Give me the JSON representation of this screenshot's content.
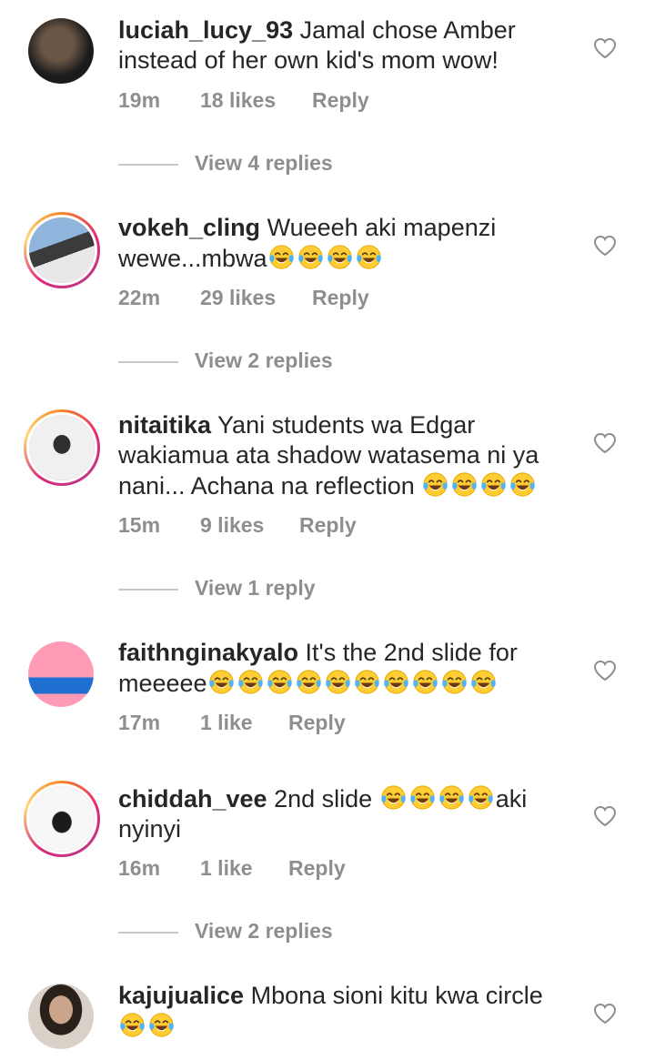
{
  "comments": [
    {
      "user": "luciah_lucy_93",
      "text": "Jamal chose Amber instead of her own kid's mom wow!",
      "emojis": 0,
      "time": "19m",
      "likes": "18 likes",
      "reply": "Reply",
      "view_replies": "View 4 replies",
      "avatar_colors": [
        "#1b1b1b",
        "#5a4636"
      ]
    },
    {
      "user": "vokeh_cling",
      "text": "Wueeeh aki mapenzi wewe...mbwa",
      "emojis": 4,
      "time": "22m",
      "likes": "29 likes",
      "reply": "Reply",
      "view_replies": "View 2 replies",
      "avatar_colors": [
        "#7a9ec9",
        "#d7dbe0"
      ]
    },
    {
      "user": "nitaitika",
      "text": "Yani students wa Edgar wakiamua ata shadow watasema ni ya nani... Achana na reflection ",
      "emojis": 4,
      "time": "15m",
      "likes": "9 likes",
      "reply": "Reply",
      "view_replies": "View 1 reply",
      "avatar_colors": [
        "#e9e9e9",
        "#3a3a3a"
      ]
    },
    {
      "user": "faithnginakyalo",
      "text": "It's the 2nd slide for meeeee",
      "emojis": 10,
      "time": "17m",
      "likes": "1 like",
      "reply": "Reply",
      "view_replies": "",
      "avatar_colors": [
        "#ff8aa8",
        "#1f6fd1"
      ]
    },
    {
      "user": "chiddah_vee",
      "text": "2nd slide ",
      "emojis": 4,
      "text_after": "aki nyinyi",
      "time": "16m",
      "likes": "1 like",
      "reply": "Reply",
      "view_replies": "View 2 replies",
      "avatar_colors": [
        "#f3f3f3",
        "#1b1b1b"
      ]
    },
    {
      "user": "kajujualice",
      "text": "Mbona sioni kitu kwa circle",
      "emojis": 2,
      "time": "",
      "likes": "",
      "reply": "",
      "view_replies": "",
      "avatar_colors": [
        "#b59a86",
        "#2a201a"
      ]
    }
  ],
  "colors": {
    "text": "#262626",
    "muted": "#8e8e8e",
    "ring": "#dd2a7b"
  },
  "icons": {
    "like": "heart-outline-icon",
    "emoji": "face-with-tears-of-joy"
  }
}
